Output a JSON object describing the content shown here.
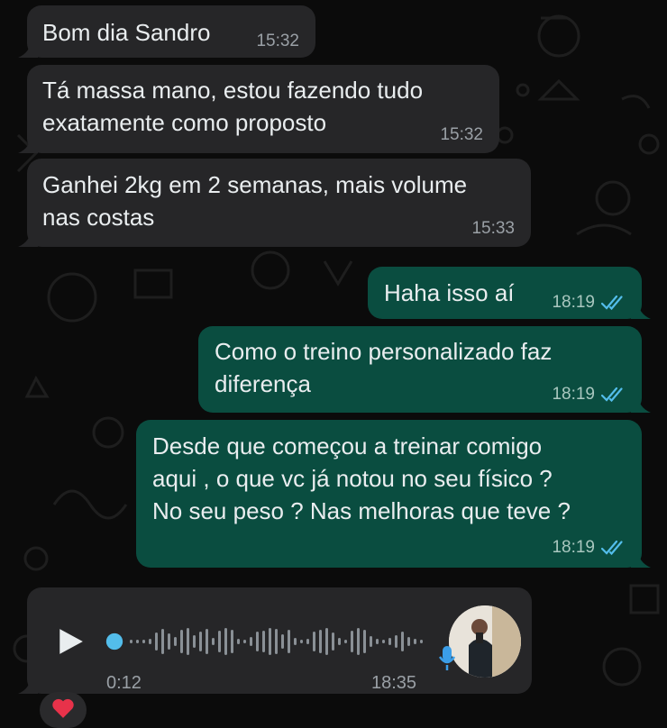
{
  "messages": [
    {
      "direction": "incoming",
      "lines": [
        "Bom dia Sandro"
      ],
      "time": "15:32"
    },
    {
      "direction": "incoming",
      "lines": [
        "Tá massa mano, estou fazendo tudo",
        "exatamente como proposto"
      ],
      "time": "15:32"
    },
    {
      "direction": "incoming",
      "lines": [
        "Ganhei 2kg em 2 semanas, mais volume",
        "nas costas"
      ],
      "time": "15:33"
    },
    {
      "direction": "outgoing",
      "lines": [
        "Haha isso aí"
      ],
      "time": "18:19",
      "status": "read"
    },
    {
      "direction": "outgoing",
      "lines": [
        "Como o treino personalizado faz",
        "diferença"
      ],
      "time": "18:19",
      "status": "read"
    },
    {
      "direction": "outgoing",
      "lines": [
        "Desde que começou a treinar comigo",
        "aqui , o que vc já notou no seu físico ?",
        "No seu peso ? Nas melhoras que teve ?"
      ],
      "time": "18:19",
      "status": "read"
    }
  ],
  "voice": {
    "duration": "0:12",
    "time": "18:35",
    "progress": 0.0
  },
  "reaction": {
    "icon": "heart-icon",
    "emoji": "❤️"
  },
  "colors": {
    "incoming": "#262628",
    "outgoing": "#0a4d40",
    "read_ticks": "#53bdeb",
    "background": "#0b0b0b"
  }
}
